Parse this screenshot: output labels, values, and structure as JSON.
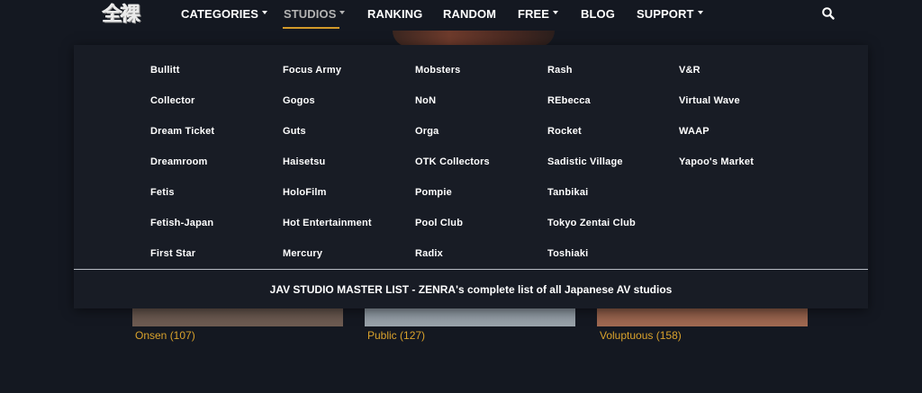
{
  "header": {
    "logo_text": "全裸",
    "nav": [
      {
        "label": "CATEGORIES",
        "has_caret": true
      },
      {
        "label": "STUDIOS",
        "has_caret": true,
        "active": true
      },
      {
        "label": "RANKING",
        "has_caret": false
      },
      {
        "label": "RANDOM",
        "has_caret": false
      },
      {
        "label": "FREE",
        "has_caret": true
      },
      {
        "label": "BLOG",
        "has_caret": false
      },
      {
        "label": "SUPPORT",
        "has_caret": true
      }
    ],
    "search_icon": "search-icon"
  },
  "studios_menu": {
    "columns": [
      [
        "Bullitt",
        "Collector",
        "Dream Ticket",
        "Dreamroom",
        "Fetis",
        "Fetish-Japan",
        "First Star"
      ],
      [
        "Focus Army",
        "Gogos",
        "Guts",
        "Haisetsu",
        "HoloFilm",
        "Hot Entertainment",
        "Mercury"
      ],
      [
        "Mobsters",
        "NoN",
        "Orga",
        "OTK Collectors",
        "Pompie",
        "Pool Club",
        "Radix"
      ],
      [
        "Rash",
        "REbecca",
        "Rocket",
        "Sadistic Village",
        "Tanbikai",
        "Tokyo Zentai Club",
        "Toshiaki"
      ],
      [
        "V&R",
        "Virtual Wave",
        "WAAP",
        "Yapoo's Market"
      ]
    ],
    "master_list_label": "JAV STUDIO MASTER LIST - ZENRA's complete list of all Japanese AV studios"
  },
  "categories": [
    {
      "label": "Onsen (107)"
    },
    {
      "label": "Public (127)"
    },
    {
      "label": "Voluptuous (158)"
    }
  ],
  "colors": {
    "background": "#141821",
    "dropdown_background": "#181c25",
    "accent": "#d39a2a",
    "category_label": "#d9a22c",
    "active_nav": "#b3b3b3"
  }
}
